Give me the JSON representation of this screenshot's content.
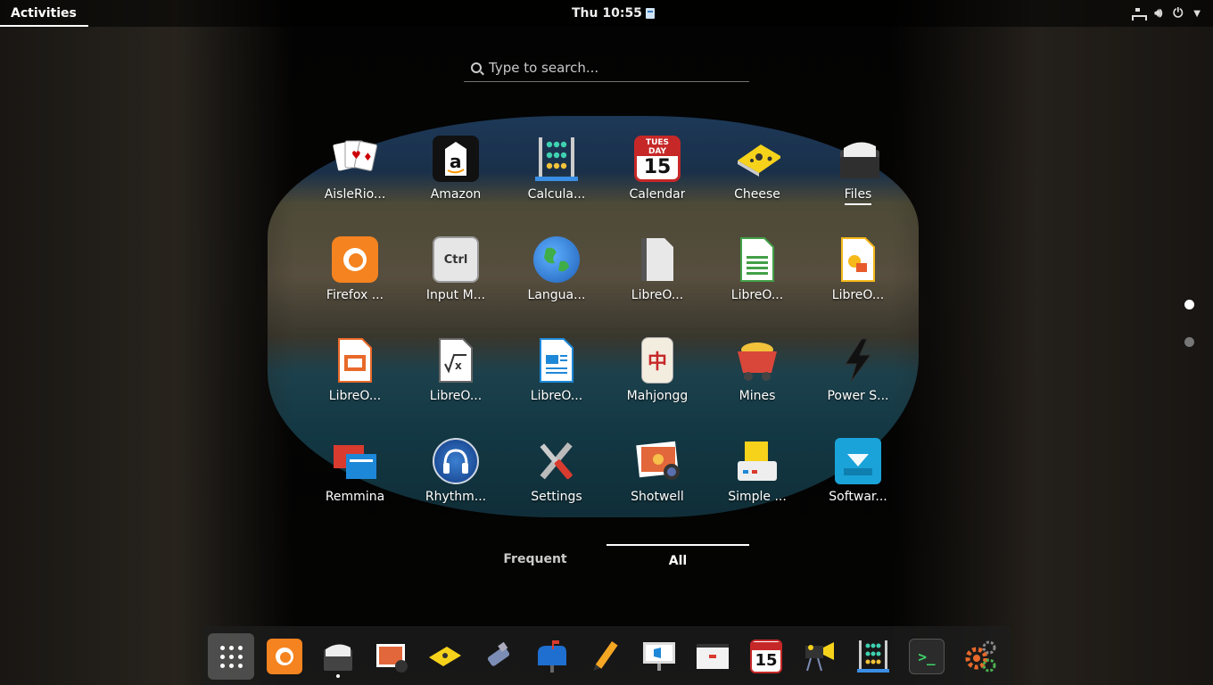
{
  "topbar": {
    "activities": "Activities",
    "clock": "Thu 10:55"
  },
  "search": {
    "placeholder": "Type to search..."
  },
  "apps": [
    {
      "label": "AisleRio...",
      "icon": "cards-icon"
    },
    {
      "label": "Amazon",
      "icon": "amazon-icon"
    },
    {
      "label": "Calcula...",
      "icon": "abacus-icon"
    },
    {
      "label": "Calendar",
      "icon": "calendar-icon"
    },
    {
      "label": "Cheese",
      "icon": "cheese-icon"
    },
    {
      "label": "Files",
      "icon": "file-cabinet-icon"
    },
    {
      "label": "Firefox ...",
      "icon": "firefox-icon"
    },
    {
      "label": "Input M...",
      "icon": "ctrl-key-icon"
    },
    {
      "label": "Langua...",
      "icon": "globe-icon"
    },
    {
      "label": "LibreO...",
      "icon": "document-icon"
    },
    {
      "label": "LibreO...",
      "icon": "spreadsheet-icon"
    },
    {
      "label": "LibreO...",
      "icon": "drawing-icon"
    },
    {
      "label": "LibreO...",
      "icon": "presentation-icon"
    },
    {
      "label": "LibreO...",
      "icon": "formula-icon"
    },
    {
      "label": "LibreO...",
      "icon": "writer-icon"
    },
    {
      "label": "Mahjongg",
      "icon": "mahjong-tile-icon"
    },
    {
      "label": "Mines",
      "icon": "mine-cart-icon"
    },
    {
      "label": "Power S...",
      "icon": "lightning-icon"
    },
    {
      "label": "Remmina",
      "icon": "remote-desktop-icon"
    },
    {
      "label": "Rhythm...",
      "icon": "headphones-icon"
    },
    {
      "label": "Settings",
      "icon": "tools-icon"
    },
    {
      "label": "Shotwell",
      "icon": "photo-icon"
    },
    {
      "label": "Simple ...",
      "icon": "scanner-icon"
    },
    {
      "label": "Softwar...",
      "icon": "software-bag-icon"
    }
  ],
  "calendar_icon": {
    "day": "TUES DAY",
    "date": "15"
  },
  "ctrl_key": "Ctrl",
  "tabs": {
    "frequent": "Frequent",
    "all": "All"
  },
  "dock": [
    "show-apps-icon",
    "firefox-icon",
    "files-icon",
    "shotwell-icon",
    "cheese-icon",
    "usb-icon",
    "mailbox-icon",
    "pencil-icon",
    "presentation-monitor-icon",
    "card-icon",
    "calendar-icon",
    "video-camera-icon",
    "abacus-icon",
    "terminal-icon",
    "gears-icon"
  ]
}
